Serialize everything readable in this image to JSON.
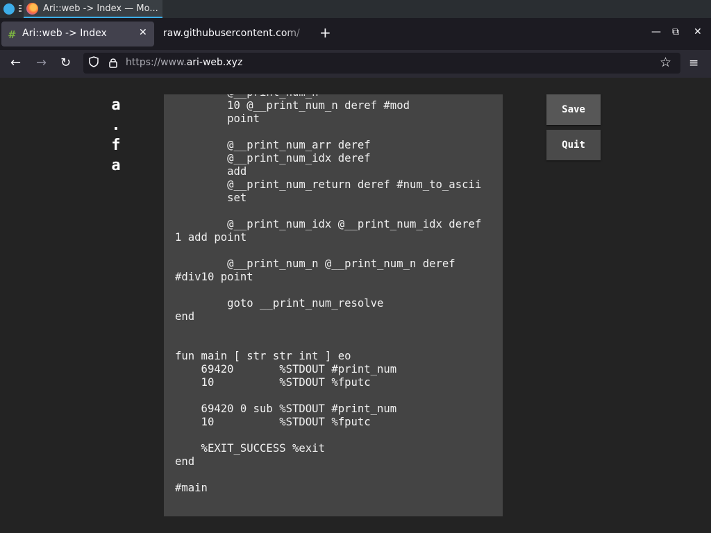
{
  "taskbar": {
    "task_title": "Ari::web -> Index — Mo..."
  },
  "tabs": {
    "active_label": "Ari::web -> Index",
    "active_favicon": "#",
    "second_label": "raw.githubusercontent.com/",
    "new_tab_symbol": "+",
    "close_symbol": "✕"
  },
  "window_controls": {
    "minimize": "—",
    "maximize": "⧉",
    "close": "✕"
  },
  "navbar": {
    "back": "←",
    "forward": "→",
    "reload": "↻",
    "url_prefix": "https://www.",
    "url_domain": "ari-web.xyz",
    "bookmark": "☆",
    "menu": "≡"
  },
  "page": {
    "brand_letters": [
      "a",
      ".",
      "f",
      "a"
    ],
    "save_label": "Save",
    "quit_label": "Quit",
    "code": "        @__print_num_n\n        10 @__print_num_n deref #mod\n        point\n\n        @__print_num_arr deref\n        @__print_num_idx deref\n        add\n        @__print_num_return deref #num_to_ascii\n        set\n\n        @__print_num_idx @__print_num_idx deref\n1 add point\n\n        @__print_num_n @__print_num_n deref\n#div10 point\n\n        goto __print_num_resolve\nend\n\n\nfun main [ str str int ] eo\n    69420       %STDOUT #print_num\n    10          %STDOUT %fputc\n\n    69420 0 sub %STDOUT #print_num\n    10          %STDOUT %fputc\n\n    %EXIT_SUCCESS %exit\nend\n\n#main"
  },
  "colors": {
    "page_background": "#232323",
    "editor_background": "#444444",
    "button_background": "#4a4a4a",
    "tabbar_background": "#1c1b22",
    "navbar_background": "#2b2a33"
  }
}
